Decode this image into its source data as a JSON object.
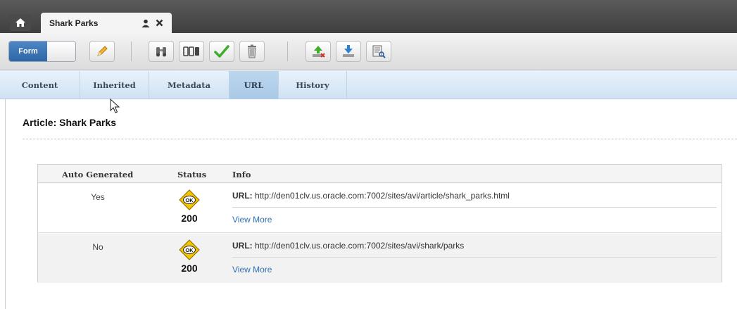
{
  "tab": {
    "title": "Shark Parks"
  },
  "toolbar": {
    "form_label": "Form",
    "buttons": [
      "edit-icon",
      "find-icon",
      "preview-icon",
      "approve-icon",
      "delete-icon",
      "publish-icon",
      "download-icon",
      "inspect-icon"
    ]
  },
  "subtabs": [
    "Content",
    "Inherited",
    "Metadata",
    "URL",
    "History"
  ],
  "active_subtab": "URL",
  "page_title": "Article: Shark Parks",
  "table": {
    "headers": {
      "auto": "Auto Generated",
      "status": "Status",
      "info": "Info"
    },
    "rows": [
      {
        "auto": "Yes",
        "badge": "OK",
        "code": "200",
        "url_label": "URL:",
        "url": " http://den01clv.us.oracle.com:7002/sites/avi/article/shark_parks.html",
        "more": "View More"
      },
      {
        "auto": "No",
        "badge": "OK",
        "code": "200",
        "url_label": "URL:",
        "url": " http://den01clv.us.oracle.com:7002/sites/avi/shark/parks",
        "more": "View More"
      }
    ]
  },
  "colors": {
    "accent": "#2e66a6",
    "link": "#2f70b3",
    "badge": "#f5c400"
  }
}
